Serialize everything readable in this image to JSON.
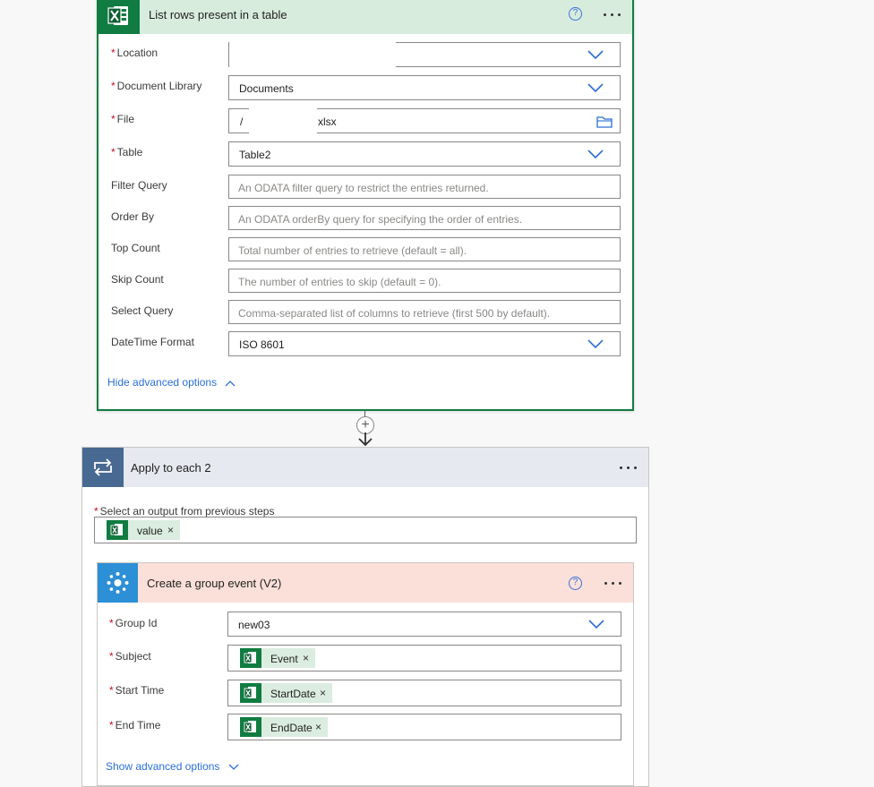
{
  "list_rows": {
    "title": "List rows present in a table",
    "help_glyph": "?",
    "fields": {
      "location": {
        "label": "Location",
        "value": ""
      },
      "document_library": {
        "label": "Document Library",
        "value": "Documents"
      },
      "file": {
        "label": "File",
        "value_prefix": "/",
        "value_suffix": "xlsx"
      },
      "table": {
        "label": "Table",
        "value": "Table2"
      },
      "filter_query": {
        "label": "Filter Query",
        "placeholder": "An ODATA filter query to restrict the entries returned."
      },
      "order_by": {
        "label": "Order By",
        "placeholder": "An ODATA orderBy query for specifying the order of entries."
      },
      "top_count": {
        "label": "Top Count",
        "placeholder": "Total number of entries to retrieve (default = all)."
      },
      "skip_count": {
        "label": "Skip Count",
        "placeholder": "The number of entries to skip (default = 0)."
      },
      "select_query": {
        "label": "Select Query",
        "placeholder": "Comma-separated list of columns to retrieve (first 500 by default)."
      },
      "datetime_format": {
        "label": "DateTime Format",
        "value": "ISO 8601"
      }
    },
    "toggle_advanced": "Hide advanced options"
  },
  "connector": {
    "plus_glyph": "+"
  },
  "apply_each": {
    "title": "Apply to each 2",
    "select_label": "Select an output from previous steps",
    "token": "value"
  },
  "group_event": {
    "title": "Create a group event (V2)",
    "help_glyph": "?",
    "fields": {
      "group_id": {
        "label": "Group Id",
        "value": "new03"
      },
      "subject": {
        "label": "Subject",
        "token": "Event"
      },
      "start_time": {
        "label": "Start Time",
        "token": "StartDate"
      },
      "end_time": {
        "label": "End Time",
        "token": "EndDate"
      }
    },
    "toggle_advanced": "Show advanced options"
  },
  "common": {
    "required_mark": "*",
    "remove_glyph": "×"
  },
  "colors": {
    "excel_green": "#107c41",
    "excel_header": "#d8ecde",
    "loop_blue": "#486991",
    "loop_header": "#e6e9ef",
    "groups_blue": "#2d8fd5",
    "groups_header": "#fbe0da",
    "link_blue": "#2b6fd6",
    "required_red": "#c50f1f"
  },
  "icons": [
    "excel-icon",
    "help-icon",
    "more-options-icon",
    "chevron-down-icon",
    "folder-icon",
    "chevron-up-icon",
    "plus-icon",
    "arrow-down-icon",
    "loop-icon",
    "groups-icon",
    "remove-icon"
  ]
}
